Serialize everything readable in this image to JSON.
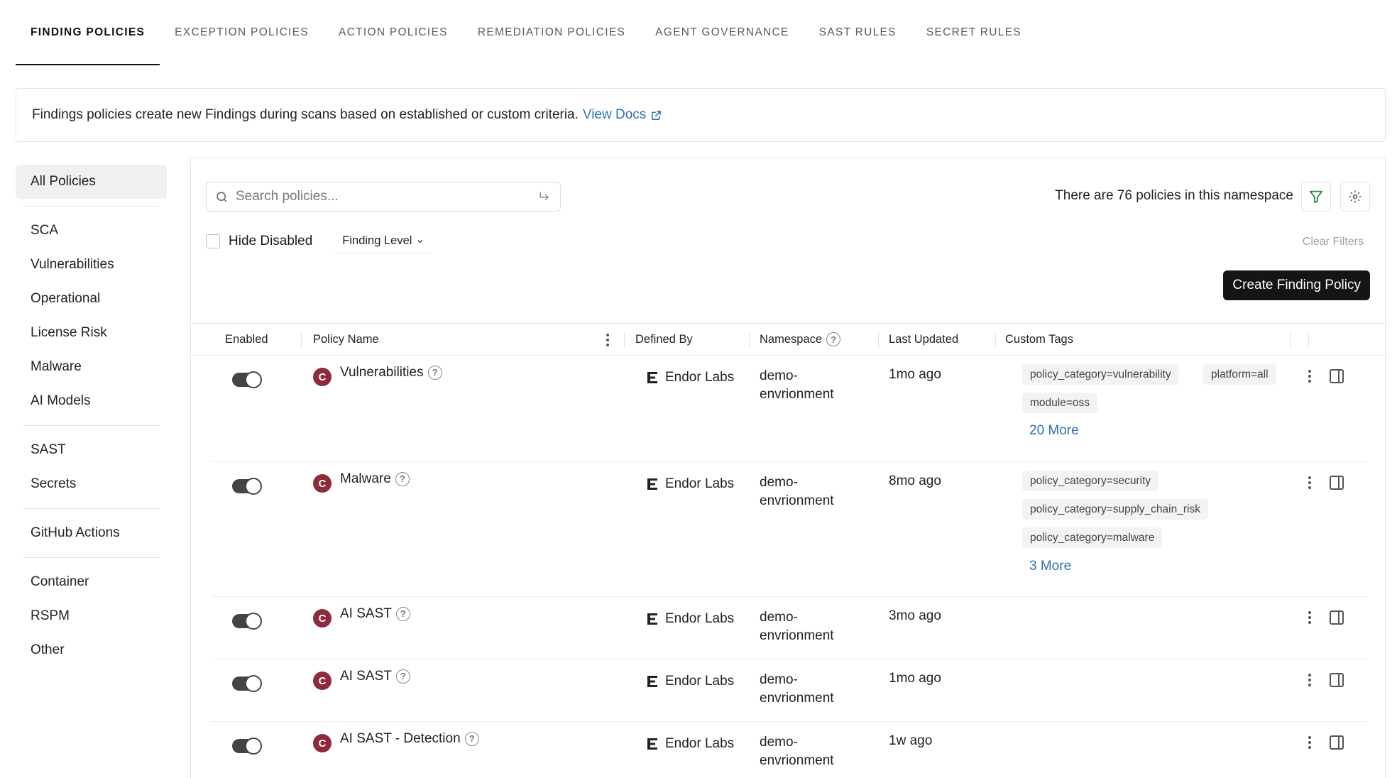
{
  "tabs": [
    {
      "label": "FINDING POLICIES",
      "active": true
    },
    {
      "label": "EXCEPTION POLICIES"
    },
    {
      "label": "ACTION POLICIES"
    },
    {
      "label": "REMEDIATION POLICIES"
    },
    {
      "label": "AGENT GOVERNANCE"
    },
    {
      "label": "SAST RULES"
    },
    {
      "label": "SECRET RULES"
    }
  ],
  "banner": {
    "text": "Findings policies create new Findings during scans based on established or custom criteria.",
    "link": "View Docs"
  },
  "sidebar": {
    "items": [
      "All Policies",
      "SCA",
      "Vulnerabilities",
      "Operational",
      "License Risk",
      "Malware",
      "AI Models",
      "SAST",
      "Secrets",
      "GitHub Actions",
      "Container",
      "RSPM",
      "Other"
    ]
  },
  "search": {
    "placeholder": "Search policies..."
  },
  "count_text": "There are 76 policies in this namespace",
  "filters": {
    "hide_disabled": "Hide Disabled",
    "finding_level": "Finding Level",
    "clear": "Clear Filters"
  },
  "create_button": "Create Finding Policy",
  "table": {
    "headers": {
      "enabled": "Enabled",
      "policy_name": "Policy Name",
      "defined_by": "Defined By",
      "namespace": "Namespace",
      "last_updated": "Last Updated",
      "custom_tags": "Custom Tags"
    },
    "rows": [
      {
        "badge": "C",
        "name": "Vulnerabilities",
        "defined_by": "Endor Labs",
        "namespace_line1": "demo-",
        "namespace_line2": "envrionment",
        "updated": "1mo ago",
        "tags": [
          "policy_category=vulnerability",
          "platform=all",
          "module=oss"
        ],
        "more": "20 More",
        "enabled": true
      },
      {
        "badge": "C",
        "name": "Malware",
        "defined_by": "Endor Labs",
        "namespace_line1": "demo-",
        "namespace_line2": "envrionment",
        "updated": "8mo ago",
        "tags": [
          "policy_category=security",
          "policy_category=supply_chain_risk",
          "policy_category=malware"
        ],
        "more": "3 More",
        "enabled": true
      },
      {
        "badge": "C",
        "name": "AI SAST",
        "defined_by": "Endor Labs",
        "namespace_line1": "demo-",
        "namespace_line2": "envrionment",
        "updated": "3mo ago",
        "enabled": true
      },
      {
        "badge": "C",
        "name": "AI SAST",
        "defined_by": "Endor Labs",
        "namespace_line1": "demo-",
        "namespace_line2": "envrionment",
        "updated": "1mo ago",
        "enabled": true
      },
      {
        "badge": "C",
        "name": "AI SAST - Detection",
        "defined_by": "Endor Labs",
        "namespace_line1": "demo-",
        "namespace_line2": "envrionment",
        "updated": "1w ago",
        "enabled": true
      }
    ]
  },
  "colors": {
    "accent_link": "#2f6fb6",
    "badge": "#8f2a3a",
    "button_dark": "#151515"
  }
}
